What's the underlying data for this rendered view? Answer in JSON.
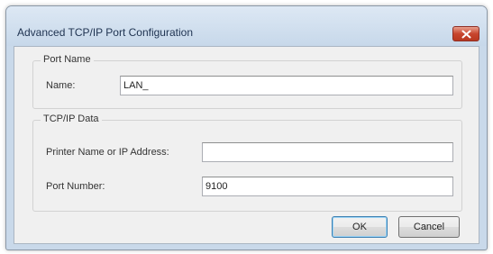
{
  "window": {
    "title": "Advanced TCP/IP Port Configuration"
  },
  "port_name_group": {
    "legend": "Port Name",
    "name_label": "Name:",
    "name_value": "LAN_"
  },
  "tcpip_group": {
    "legend": "TCP/IP Data",
    "printer_label": "Printer Name or IP Address:",
    "printer_value": "",
    "port_label": "Port Number:",
    "port_value": "9100"
  },
  "buttons": {
    "ok": "OK",
    "cancel": "Cancel"
  },
  "colors": {
    "close_button": "#c8462e",
    "dialog_face": "#f0f0f0",
    "frame": "#c9d9ea"
  },
  "icons": {
    "close": "close-icon"
  }
}
